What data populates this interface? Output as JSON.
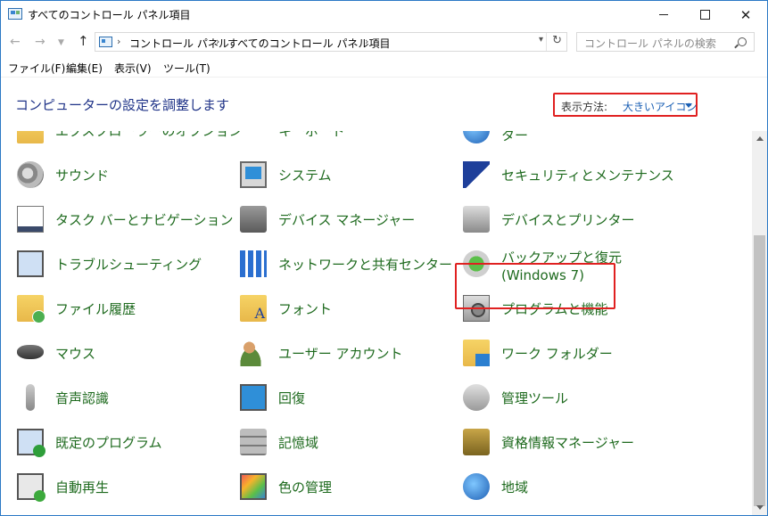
{
  "window": {
    "title": "すべてのコントロール パネル項目",
    "close_glyph": "✕"
  },
  "nav": {
    "back": "←",
    "forward": "→",
    "up": "↑",
    "address": [
      "コントロール パネル",
      "すべてのコントロール パネル項目"
    ],
    "search_placeholder": "コントロール パネルの検索"
  },
  "menu": [
    "ファイル(F)",
    "編集(E)",
    "表示(V)",
    "ツール(T)"
  ],
  "header": {
    "title": "コンピューターの設定を調整します",
    "view_by_label": "表示方法:",
    "view_by_value": "大きいアイコン"
  },
  "items": [
    {
      "label": "エクスプローラーのオプション",
      "icon": "folder-options-icon"
    },
    {
      "label": "キーボード",
      "icon": "keyboard-icon"
    },
    {
      "label": "ター",
      "icon": "sync-center-icon"
    },
    {
      "label": "サウンド",
      "icon": "speaker-icon"
    },
    {
      "label": "システム",
      "icon": "system-monitor-icon"
    },
    {
      "label": "セキュリティとメンテナンス",
      "icon": "security-flag-icon"
    },
    {
      "label": "タスク バーとナビゲーション",
      "icon": "taskbar-icon"
    },
    {
      "label": "デバイス マネージャー",
      "icon": "device-manager-icon"
    },
    {
      "label": "デバイスとプリンター",
      "icon": "printer-icon"
    },
    {
      "label": "トラブルシューティング",
      "icon": "troubleshooting-icon"
    },
    {
      "label": "ネットワークと共有センター",
      "icon": "network-icon"
    },
    {
      "label": "バックアップと復元 (Windows 7)",
      "icon": "backup-icon"
    },
    {
      "label": "ファイル履歴",
      "icon": "file-history-icon"
    },
    {
      "label": "フォント",
      "icon": "fonts-folder-icon"
    },
    {
      "label": "プログラムと機能",
      "icon": "programs-icon"
    },
    {
      "label": "マウス",
      "icon": "mouse-icon"
    },
    {
      "label": "ユーザー アカウント",
      "icon": "user-accounts-icon"
    },
    {
      "label": "ワーク フォルダー",
      "icon": "work-folders-icon"
    },
    {
      "label": "音声認識",
      "icon": "microphone-icon"
    },
    {
      "label": "回復",
      "icon": "recovery-icon"
    },
    {
      "label": "管理ツール",
      "icon": "admin-tools-icon"
    },
    {
      "label": "既定のプログラム",
      "icon": "default-programs-icon"
    },
    {
      "label": "記憶域",
      "icon": "storage-icon"
    },
    {
      "label": "資格情報マネージャー",
      "icon": "credential-vault-icon"
    },
    {
      "label": "自動再生",
      "icon": "autoplay-icon"
    },
    {
      "label": "色の管理",
      "icon": "color-management-icon"
    },
    {
      "label": "地域",
      "icon": "region-globe-icon"
    }
  ],
  "highlight_item": "プログラムと機能",
  "colors": {
    "link_green": "#1e6a1e",
    "title_blue": "#1e3287",
    "highlight_red": "#e02020",
    "view_value_blue": "#1a5fb4"
  }
}
